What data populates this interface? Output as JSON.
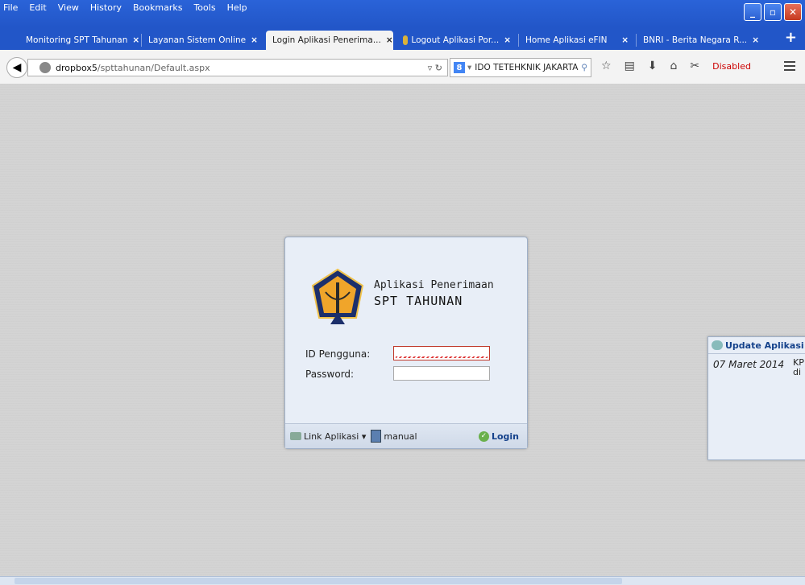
{
  "menu": [
    "File",
    "Edit",
    "View",
    "History",
    "Bookmarks",
    "Tools",
    "Help"
  ],
  "tabs": [
    {
      "label": "Monitoring SPT Tahunan",
      "active": false
    },
    {
      "label": "Layanan Sistem Online",
      "active": false
    },
    {
      "label": "Login Aplikasi Penerima...",
      "active": true
    },
    {
      "label": "Logout Aplikasi Por...",
      "active": false
    },
    {
      "label": "Home Aplikasi eFIN",
      "active": false
    },
    {
      "label": "BNRI - Berita Negara R...",
      "active": false
    }
  ],
  "tab_close": "×",
  "new_tab": "+",
  "url": {
    "host": "dropbox5",
    "path": "/spttahunan/Default.aspx"
  },
  "search": {
    "engine": "8",
    "value": "IDO TETEHKNIK JAKARTA"
  },
  "toolbar": {
    "disabled_label": "Disabled"
  },
  "login": {
    "app_title_line1": "Aplikasi Penerimaan",
    "app_title_line2": "SPT TAHUNAN",
    "user_label": "ID Pengguna:",
    "password_label": "Password:",
    "user_value": "",
    "password_value": "",
    "link_aplikasi": "Link Aplikasi ▾",
    "manual": "manual",
    "login_button": "Login"
  },
  "updates": {
    "title": "Update Aplikasi",
    "date": "07 Maret 2014",
    "truncated_text": [
      "KP",
      "di"
    ]
  },
  "colors": {
    "titlebar": "#2256c8",
    "panel": "#e8eef7",
    "accent": "#15428b"
  }
}
